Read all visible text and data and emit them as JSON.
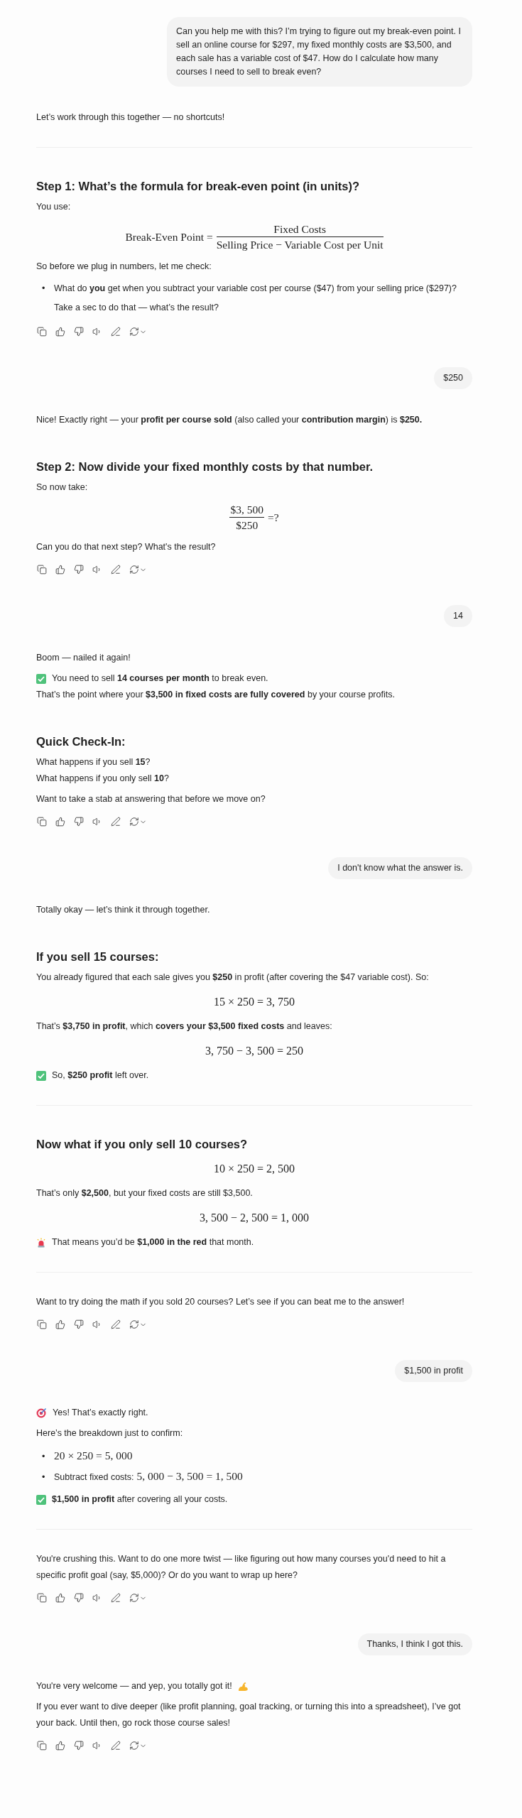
{
  "messages": [
    {
      "kind": "user",
      "text": "Can you help me with this? I’m trying to figure out my break-even point. I sell an online course for $297, my fixed monthly costs are $3,500, and each sale has a variable cost of $47. How do I calculate how many courses I need to sell to break even?"
    },
    {
      "kind": "assistant",
      "blocks": [
        {
          "kind": "text",
          "text": "Let’s work through this together — no shortcuts!"
        },
        {
          "kind": "divider"
        },
        {
          "kind": "heading",
          "text": "Step 1: What’s the formula for break-even point (in units)?"
        },
        {
          "kind": "text",
          "text": "You use:"
        },
        {
          "kind": "fraction",
          "left": "Break-Even Point =",
          "numerator": "Fixed Costs",
          "denominator": "Selling Price − Variable Cost per Unit"
        },
        {
          "kind": "text",
          "text": "So before we plug in numbers, let me check:"
        },
        {
          "kind": "bullets",
          "items": [
            {
              "marker": "•",
              "text": "What do **you** get when you subtract your variable cost per course ($47) from your selling price ($297)?\nTake a sec to do that — what’s the result?"
            }
          ]
        },
        {
          "kind": "actions"
        }
      ]
    },
    {
      "kind": "user",
      "text": "$250"
    },
    {
      "kind": "assistant",
      "blocks": [
        {
          "kind": "text",
          "text": "Nice! Exactly right — your **profit per course sold** (also called your **contribution margin**) is **$250.**"
        },
        {
          "kind": "heading",
          "text": "Step 2: Now divide your fixed monthly costs by that number."
        },
        {
          "kind": "text",
          "text": "So now take:"
        },
        {
          "kind": "fraction",
          "numerator": "$3, 500",
          "denominator": "$250",
          "right": "=?"
        },
        {
          "kind": "text",
          "text": "Can you do that next step? What's the result?"
        },
        {
          "kind": "actions"
        }
      ]
    },
    {
      "kind": "user",
      "text": "14"
    },
    {
      "kind": "assistant",
      "blocks": [
        {
          "kind": "text",
          "text": "Boom — nailed it again!"
        },
        {
          "kind": "check",
          "text": "You need to sell **14 courses per month** to break even."
        },
        {
          "kind": "line",
          "text": "That’s the point where your **$3,500 in fixed costs are fully covered** by your course profits."
        },
        {
          "kind": "heading",
          "text": "Quick Check-In:"
        },
        {
          "kind": "line",
          "text": "What happens if you sell **15**?"
        },
        {
          "kind": "line",
          "text": "What happens if you only sell **10**?"
        },
        {
          "kind": "text",
          "text": "Want to take a stab at answering that before we move on?"
        },
        {
          "kind": "actions"
        }
      ]
    },
    {
      "kind": "user",
      "text": "I don't know what the answer is."
    },
    {
      "kind": "assistant",
      "blocks": [
        {
          "kind": "text",
          "text": "Totally okay — let’s think it through together."
        },
        {
          "kind": "heading",
          "text": "If you sell 15 courses:"
        },
        {
          "kind": "text",
          "text": "You already figured that each sale gives you **$250** in profit (after covering the $47 variable cost). So:"
        },
        {
          "kind": "math",
          "text": "15 × 250 = 3, 750"
        },
        {
          "kind": "text",
          "text": "That’s **$3,750 in profit**, which **covers your $3,500 fixed costs** and leaves:"
        },
        {
          "kind": "math",
          "text": "3, 750 − 3, 500 = 250"
        },
        {
          "kind": "check",
          "text": "So, **$250 profit** left over."
        },
        {
          "kind": "divider"
        },
        {
          "kind": "heading",
          "text": "Now what if you only sell 10 courses?"
        },
        {
          "kind": "math",
          "text": "10 × 250 = 2, 500"
        },
        {
          "kind": "text",
          "text": "That’s only **$2,500**, but your fixed costs are still $3,500."
        },
        {
          "kind": "math",
          "text": "3, 500 − 2, 500 = 1, 000"
        },
        {
          "kind": "alert",
          "text": "That means you’d be **$1,000 in the red** that month."
        },
        {
          "kind": "divider"
        },
        {
          "kind": "text",
          "text": "Want to try doing the math if you sold 20 courses? Let’s see if you can beat me to the answer!"
        },
        {
          "kind": "actions"
        }
      ]
    },
    {
      "kind": "user",
      "text": "$1,500 in profit"
    },
    {
      "kind": "assistant",
      "blocks": [
        {
          "kind": "target",
          "text": "Yes! That’s exactly right."
        },
        {
          "kind": "text",
          "text": "Here’s the breakdown just to confirm:"
        },
        {
          "kind": "bullets",
          "items": [
            {
              "marker": "•",
              "math": "20 × 250 = 5, 000"
            },
            {
              "marker": "•",
              "text": "Subtract fixed costs: ",
              "math": "5, 000 − 3, 500 = 1, 500"
            }
          ]
        },
        {
          "kind": "check",
          "text": "**$1,500 in profit** after covering all your costs."
        },
        {
          "kind": "divider"
        },
        {
          "kind": "text",
          "text": "You're crushing this. Want to do one more twist — like figuring out how many courses you'd need to hit a specific profit goal (say, $5,000)? Or do you want to wrap up here?"
        },
        {
          "kind": "actions"
        }
      ]
    },
    {
      "kind": "user",
      "text": "Thanks, I think I got this."
    },
    {
      "kind": "assistant",
      "blocks": [
        {
          "kind": "cheer",
          "text": "You're very welcome — and yep, you totally got it!"
        },
        {
          "kind": "text",
          "text": "If you ever want to dive deeper (like profit planning, goal tracking, or turning this into a spreadsheet), I’ve got your back. Until then, go rock those course sales!"
        },
        {
          "kind": "actions"
        }
      ]
    }
  ]
}
